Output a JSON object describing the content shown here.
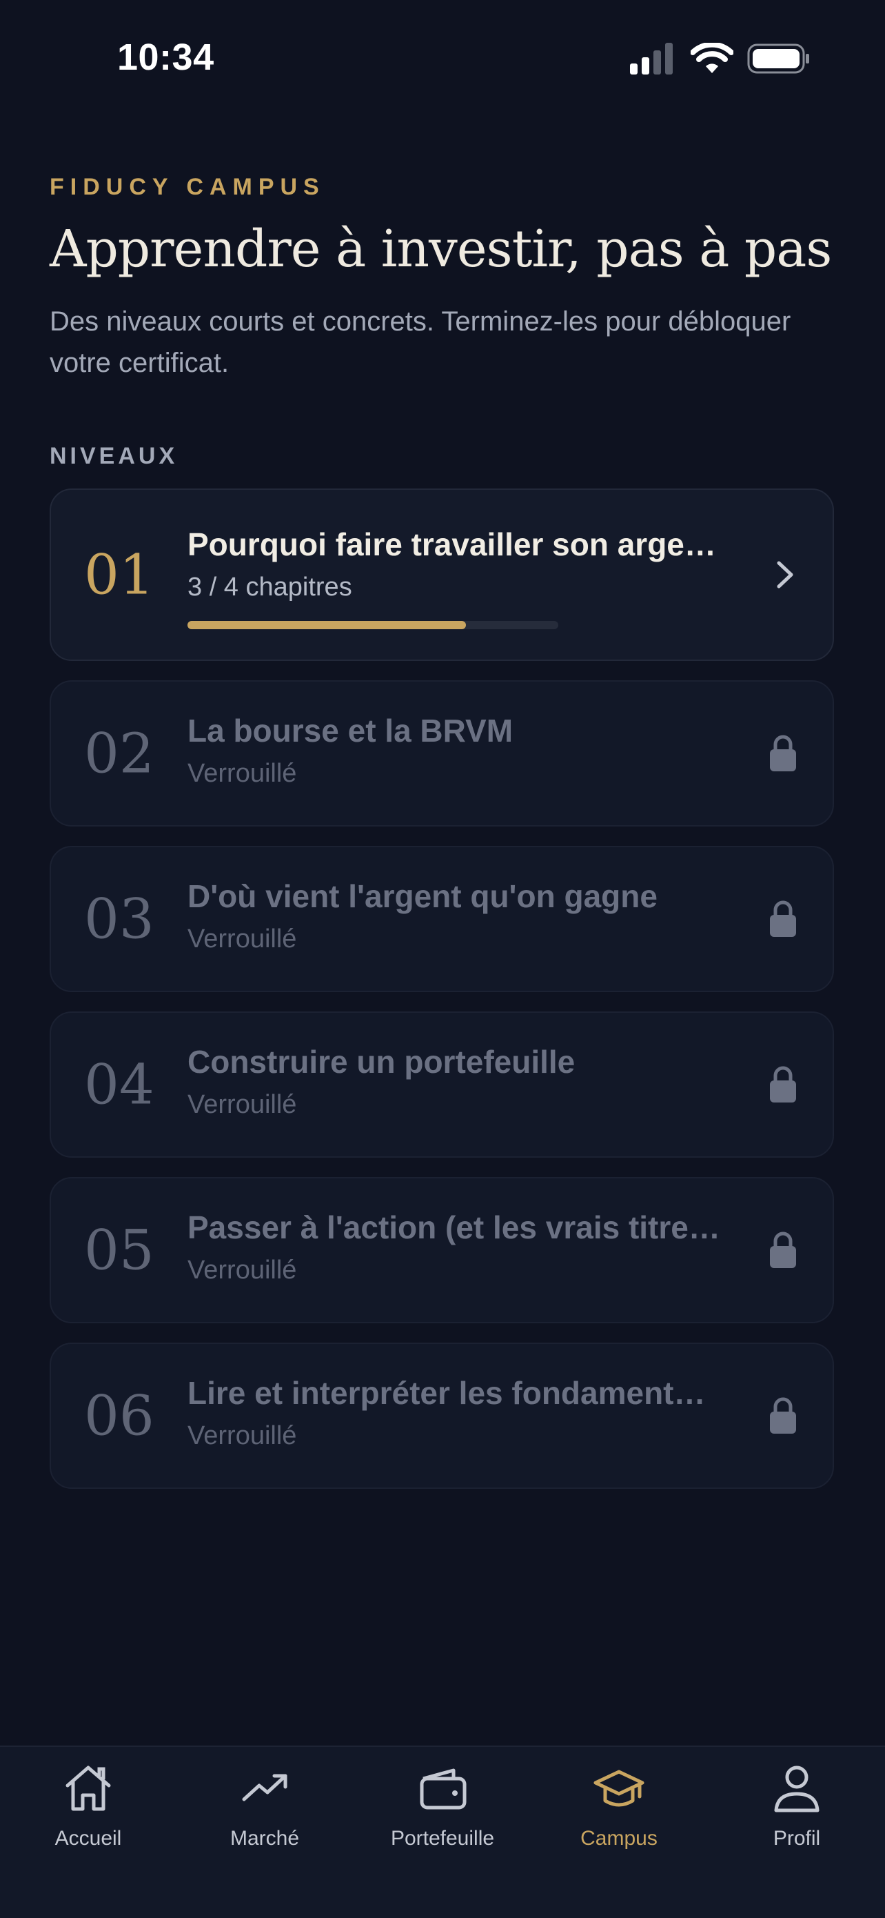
{
  "status_bar": {
    "time": "10:34"
  },
  "header": {
    "eyebrow": "FIDUCY CAMPUS",
    "title": "Apprendre à investir, pas à pas",
    "subtitle": "Des niveaux courts et concrets. Terminez-les pour débloquer votre certificat."
  },
  "section_label": "NIVEAUX",
  "levels": [
    {
      "number": "01",
      "title": "Pourquoi faire travailler son arge…",
      "status": "3 / 4 chapitres",
      "progress": 0.75,
      "locked": false
    },
    {
      "number": "02",
      "title": "La bourse et la BRVM",
      "status": "Verrouillé",
      "locked": true
    },
    {
      "number": "03",
      "title": "D'où vient l'argent qu'on gagne",
      "status": "Verrouillé",
      "locked": true
    },
    {
      "number": "04",
      "title": "Construire un portefeuille",
      "status": "Verrouillé",
      "locked": true
    },
    {
      "number": "05",
      "title": "Passer à l'action (et les vrais titre…",
      "status": "Verrouillé",
      "locked": true
    },
    {
      "number": "06",
      "title": "Lire et interpréter les fondament…",
      "status": "Verrouillé",
      "locked": true
    }
  ],
  "tabbar": {
    "items": [
      {
        "label": "Accueil",
        "icon": "home-icon"
      },
      {
        "label": "Marché",
        "icon": "trending-up-icon"
      },
      {
        "label": "Portefeuille",
        "icon": "wallet-icon"
      },
      {
        "label": "Campus",
        "icon": "graduation-cap-icon",
        "active": true
      },
      {
        "label": "Profil",
        "icon": "user-icon"
      }
    ]
  },
  "colors": {
    "accent": "#c9a560",
    "background": "#0e1220",
    "card": "#121828"
  }
}
